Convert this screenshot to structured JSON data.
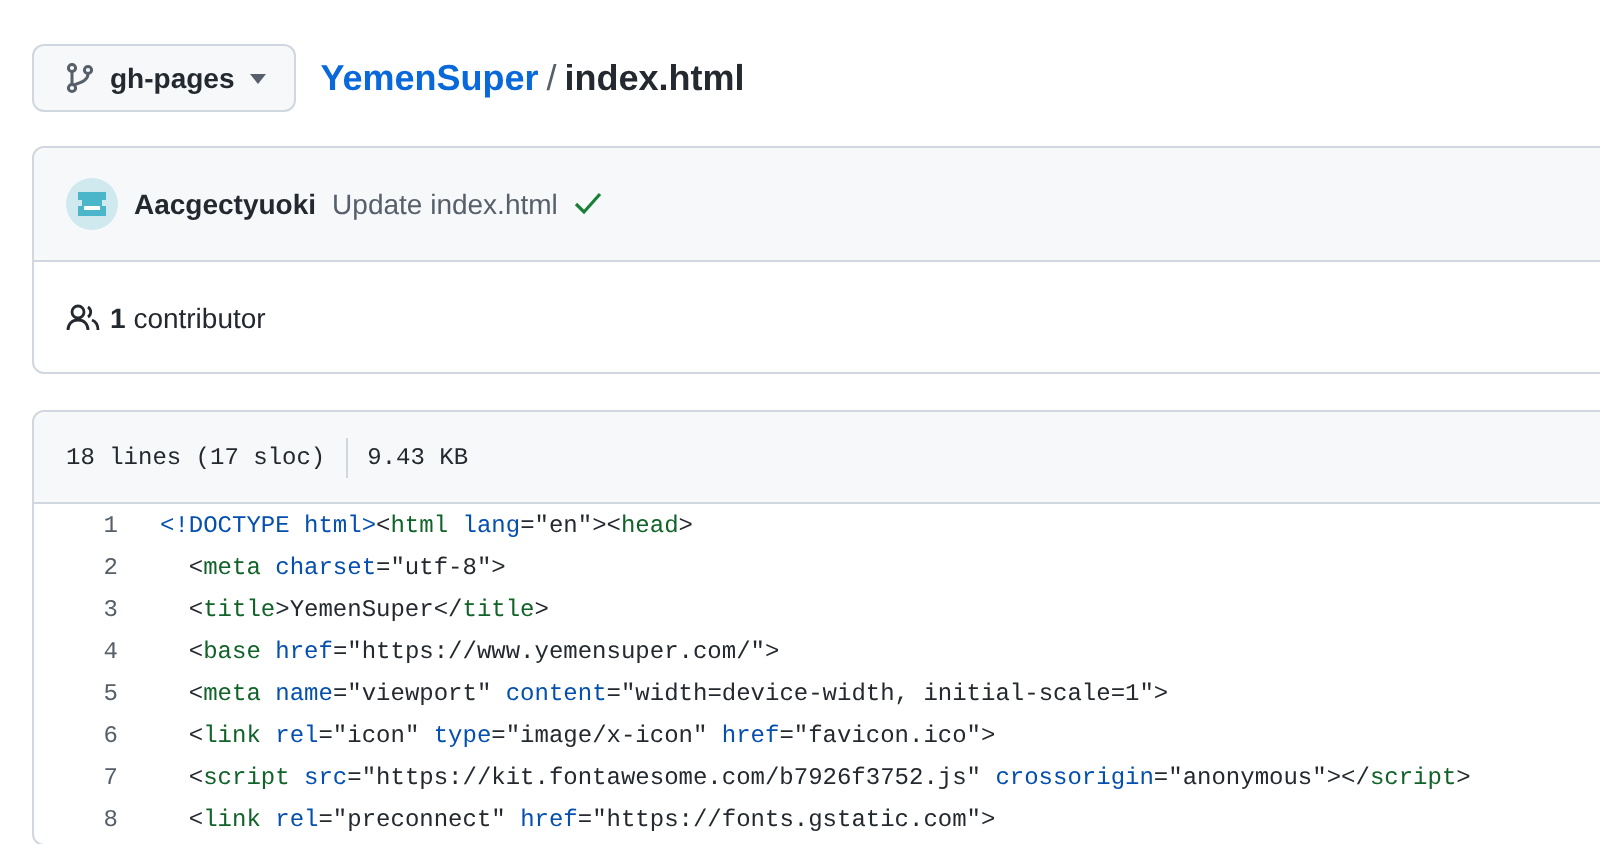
{
  "branch": {
    "label": "gh-pages"
  },
  "breadcrumb": {
    "repo": "YemenSuper",
    "separator": "/",
    "file": "index.html"
  },
  "commit": {
    "author": "Aacgectyuoki",
    "message": "Update index.html",
    "verified": true
  },
  "contributors": {
    "count": "1",
    "label": "contributor"
  },
  "file_info": {
    "lines": "18 lines (17 sloc)",
    "size": "9.43 KB"
  },
  "code_lines": [
    {
      "number": "1",
      "tokens": [
        {
          "kind": "keyword",
          "text": "<!DOCTYPE html>"
        },
        {
          "kind": "punct",
          "text": "<"
        },
        {
          "kind": "tag",
          "text": "html"
        },
        {
          "kind": "attr",
          "text": " lang"
        },
        {
          "kind": "punct",
          "text": "=\"en\"><"
        },
        {
          "kind": "tag",
          "text": "head"
        },
        {
          "kind": "punct",
          "text": ">"
        }
      ]
    },
    {
      "number": "2",
      "tokens": [
        {
          "kind": "punct",
          "text": "  <"
        },
        {
          "kind": "tag",
          "text": "meta"
        },
        {
          "kind": "attr",
          "text": " charset"
        },
        {
          "kind": "punct",
          "text": "=\"utf-8\">"
        }
      ]
    },
    {
      "number": "3",
      "tokens": [
        {
          "kind": "punct",
          "text": "  <"
        },
        {
          "kind": "tag",
          "text": "title"
        },
        {
          "kind": "punct",
          "text": ">YemenSuper</"
        },
        {
          "kind": "tag",
          "text": "title"
        },
        {
          "kind": "punct",
          "text": ">"
        }
      ]
    },
    {
      "number": "4",
      "tokens": [
        {
          "kind": "punct",
          "text": "  <"
        },
        {
          "kind": "tag",
          "text": "base"
        },
        {
          "kind": "attr",
          "text": " href"
        },
        {
          "kind": "punct",
          "text": "=\"https://www.yemensuper.com/\">"
        }
      ]
    },
    {
      "number": "5",
      "tokens": [
        {
          "kind": "punct",
          "text": "  <"
        },
        {
          "kind": "tag",
          "text": "meta"
        },
        {
          "kind": "attr",
          "text": " name"
        },
        {
          "kind": "punct",
          "text": "=\"viewport\" "
        },
        {
          "kind": "attr",
          "text": "content"
        },
        {
          "kind": "punct",
          "text": "=\"width=device-width, initial-scale=1\">"
        }
      ]
    },
    {
      "number": "6",
      "tokens": [
        {
          "kind": "punct",
          "text": "  <"
        },
        {
          "kind": "tag",
          "text": "link"
        },
        {
          "kind": "attr",
          "text": " rel"
        },
        {
          "kind": "punct",
          "text": "=\"icon\" "
        },
        {
          "kind": "attr",
          "text": "type"
        },
        {
          "kind": "punct",
          "text": "=\"image/x-icon\" "
        },
        {
          "kind": "attr",
          "text": "href"
        },
        {
          "kind": "punct",
          "text": "=\"favicon.ico\">"
        }
      ]
    },
    {
      "number": "7",
      "tokens": [
        {
          "kind": "punct",
          "text": "  <"
        },
        {
          "kind": "tag",
          "text": "script"
        },
        {
          "kind": "attr",
          "text": " src"
        },
        {
          "kind": "punct",
          "text": "=\"https://kit.fontawesome.com/b7926f3752.js\" "
        },
        {
          "kind": "attr",
          "text": "crossorigin"
        },
        {
          "kind": "punct",
          "text": "=\"anonymous\"></"
        },
        {
          "kind": "tag",
          "text": "script"
        },
        {
          "kind": "punct",
          "text": ">"
        }
      ]
    },
    {
      "number": "8",
      "tokens": [
        {
          "kind": "punct",
          "text": "  <"
        },
        {
          "kind": "tag",
          "text": "link"
        },
        {
          "kind": "attr",
          "text": " rel"
        },
        {
          "kind": "punct",
          "text": "=\"preconnect\" "
        },
        {
          "kind": "attr",
          "text": "href"
        },
        {
          "kind": "punct",
          "text": "=\"https://fonts.gstatic.com\">"
        }
      ]
    }
  ]
}
